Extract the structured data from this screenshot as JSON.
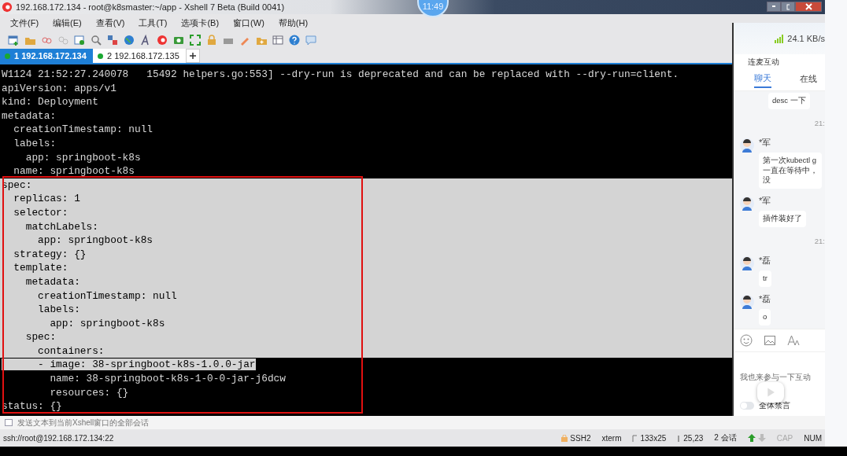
{
  "window": {
    "title": "192.168.172.134 - root@k8smaster:~/app - Xshell 7 Beta (Build 0041)"
  },
  "clock": "11:49",
  "menu": [
    "文件(F)",
    "编辑(E)",
    "查看(V)",
    "工具(T)",
    "选项卡(B)",
    "窗口(W)",
    "帮助(H)"
  ],
  "tabs": [
    {
      "label": "1 192.168.172.134",
      "selected": true
    },
    {
      "label": "2 192.168.172.135",
      "selected": false
    }
  ],
  "terminal": {
    "lines": [
      {
        "text": "W1124 21:52:27.240078   15492 helpers.go:553] --dry-run is deprecated and can be replaced with --dry-run=client.",
        "selected": false
      },
      {
        "text": "apiVersion: apps/v1",
        "selected": false
      },
      {
        "text": "kind: Deployment",
        "selected": false
      },
      {
        "text": "metadata:",
        "selected": false
      },
      {
        "text": "  creationTimestamp: null",
        "selected": false
      },
      {
        "text": "  labels:",
        "selected": false
      },
      {
        "text": "    app: springboot-k8s",
        "selected": false
      },
      {
        "text": "  name: springboot-k8s",
        "selected": false
      },
      {
        "text": "spec:",
        "selected": true
      },
      {
        "text": "  replicas: 1",
        "selected": true
      },
      {
        "text": "  selector:",
        "selected": true
      },
      {
        "text": "    matchLabels:",
        "selected": true
      },
      {
        "text": "      app: springboot-k8s",
        "selected": true
      },
      {
        "text": "  strategy: {}",
        "selected": true
      },
      {
        "text": "  template:",
        "selected": true
      },
      {
        "text": "    metadata:",
        "selected": true
      },
      {
        "text": "      creationTimestamp: null",
        "selected": true
      },
      {
        "text": "      labels:",
        "selected": true
      },
      {
        "text": "        app: springboot-k8s",
        "selected": true
      },
      {
        "text": "    spec:",
        "selected": true
      },
      {
        "text": "      containers:",
        "selected": true
      },
      {
        "text": "      - image: 38-springboot-k8s-1.0.0-jar",
        "selected": true
      },
      {
        "text": "        name: 38-springboot-k8s-1-0-0-jar-j6dcw",
        "selected": false
      },
      {
        "text": "        resources: {}",
        "selected": false
      },
      {
        "text": "status: {}",
        "selected": false
      }
    ]
  },
  "send_bar": {
    "label": "发送文本到当前Xshell窗口的全部会话",
    "checked": false
  },
  "status_bar": {
    "address": "ssh://root@192.168.172.134:22",
    "protocol": "SSH2",
    "terminal": "xterm",
    "size": "133x25",
    "cursor": "25,23",
    "sessions": "2 会话",
    "caps": "CAP",
    "num": "NUM"
  },
  "chat": {
    "speed": "24.1 KB/s",
    "mode": "连麦互动",
    "tabs": [
      {
        "label": "聊天",
        "selected": true
      },
      {
        "label": "在线",
        "selected": false
      }
    ],
    "items": [
      {
        "kind": "bubble",
        "lines": [
          "desc 一下"
        ]
      },
      {
        "kind": "time",
        "text": "21:"
      },
      {
        "kind": "message",
        "user": "*军",
        "lines": [
          "第一次kubectl g",
          "一直在等待中，",
          "没"
        ]
      },
      {
        "kind": "message",
        "user": "*军",
        "lines": [
          "插件装好了"
        ]
      },
      {
        "kind": "time",
        "text": "21:"
      },
      {
        "kind": "message",
        "user": "*磊",
        "lines": [
          "tr"
        ]
      },
      {
        "kind": "message",
        "user": "*磊",
        "lines": [
          "o"
        ]
      }
    ],
    "placeholder": "我也来参与一下互动",
    "mute": {
      "label": "全体禁言",
      "on": false
    }
  }
}
